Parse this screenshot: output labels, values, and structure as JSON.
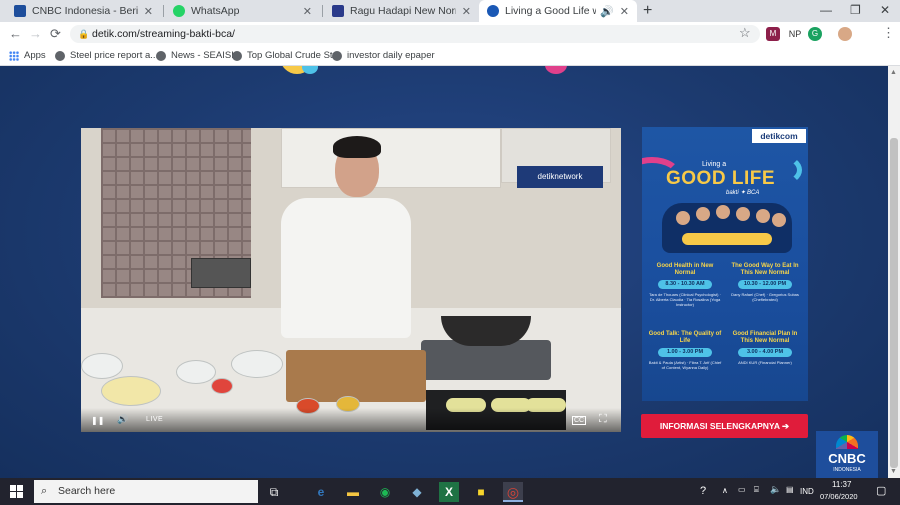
{
  "browser": {
    "tabs": [
      {
        "title": "CNBC Indonesia - Berita Ekonom",
        "favicon_color": "#1e4e9c",
        "active": false
      },
      {
        "title": "WhatsApp",
        "favicon_color": "#25d366",
        "active": false
      },
      {
        "title": "Ragu Hadapi New Normal, Yuk Ik",
        "favicon_color": "#2a3a8a",
        "active": false
      },
      {
        "title": "Living a Good Life with Bakti",
        "favicon_color": "#1a58b5",
        "active": true
      }
    ],
    "new_tab": "+",
    "window_controls": {
      "minimize": "—",
      "maximize": "❐",
      "close": "✕"
    },
    "nav": {
      "back": "←",
      "forward": "→",
      "reload": "⟳"
    },
    "url": "detik.com/streaming-bakti-bca/",
    "star_icon": "☆",
    "extensions": [
      {
        "label": "M",
        "color": "#8d1f4a"
      },
      {
        "label": "NP",
        "color": "#ffffff"
      },
      {
        "label": "G",
        "color": "#1aa260"
      }
    ],
    "bookmarks": [
      {
        "label": "Apps"
      },
      {
        "label": "Steel price report a..."
      },
      {
        "label": "News - SEAISI"
      },
      {
        "label": "Top Global Crude St..."
      },
      {
        "label": "investor daily epaper"
      }
    ]
  },
  "video": {
    "overlay_logo": "detiknetwork",
    "live_label": "LIVE",
    "controls": {
      "pause": "❚❚",
      "volume": "🔊",
      "subtitles": "CC",
      "fullscreen": "⛶"
    }
  },
  "poster": {
    "brand": "detikcom",
    "headline_small": "Living a",
    "headline_big": "GOOD LIFE",
    "headline_with": "bakti ✦ BCA",
    "sessions": [
      {
        "title": "Good Health in New Normal",
        "time": "8.30 - 10.30 AM",
        "speakers": "Tara de Thouars (Clinical Psychologist) · Dr. Alberta Claudia · Tia Rosalina (Yoga Instructor)"
      },
      {
        "title": "The Good Way to Eat In This New Normal",
        "time": "10.30 - 12.00 PM",
        "speakers": "Dany Rafael (Chef) · Gregorius Subas (Cheflebrated)"
      },
      {
        "title": "Good Talk: The Quality of Life",
        "time": "1.00 - 3.00 PM",
        "speakers": "Bakti & Paula (Artist) · Fibra T. Arif (Chief of Content, Wyanna Daily)"
      },
      {
        "title": "Good Financial Plan In This New Normal",
        "time": "3.00 - 4.00 PM",
        "speakers": "ANDI KUR (Financial Planner)"
      }
    ]
  },
  "info_button": "INFORMASI SELENGKAPNYA ➔",
  "cnbc_watermark": {
    "word": "CNBC",
    "sub": "INDONESIA"
  },
  "taskbar": {
    "search_placeholder": "Search here",
    "apps": [
      {
        "name": "task-view",
        "glyph": "⧉"
      },
      {
        "name": "edge",
        "glyph": "e",
        "color": "#3277bc"
      },
      {
        "name": "file-explorer",
        "glyph": "▬",
        "color": "#f4c542"
      },
      {
        "name": "spotify",
        "glyph": "◉",
        "color": "#1db954"
      },
      {
        "name": "app",
        "glyph": "◆",
        "color": "#7fb2d6"
      },
      {
        "name": "excel",
        "glyph": "X",
        "color": "#1f7244"
      },
      {
        "name": "sticky-notes",
        "glyph": "■",
        "color": "#f7d52c"
      },
      {
        "name": "chrome",
        "glyph": "◎",
        "color": "#db4437"
      }
    ],
    "tray_lang": "IND",
    "clock_time": "11:37",
    "clock_date": "07/06/2020"
  }
}
